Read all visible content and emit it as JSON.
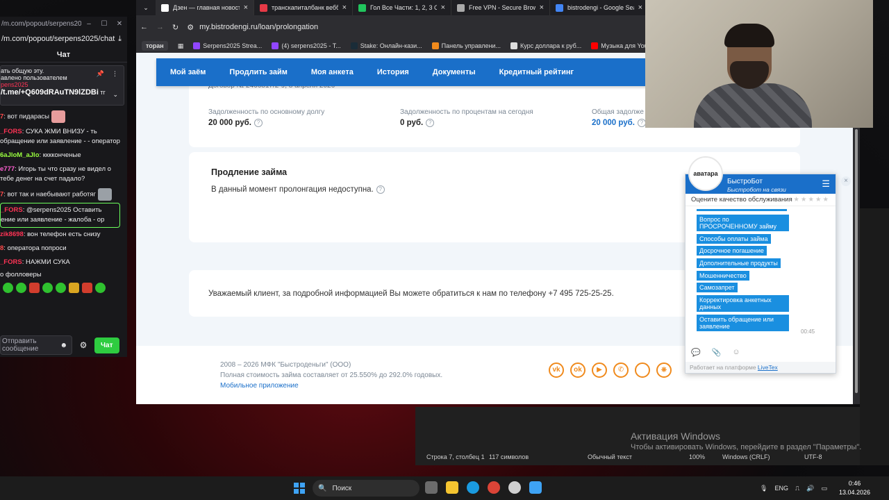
{
  "chat": {
    "window_url": "/m.com/popout/serpens20...",
    "address": "/m.com/popout/serpens2025/chat",
    "header": "Чат",
    "pinned_line1": "ать общую эту.",
    "pinned_line2": "авлено пользователем",
    "pinned_user": "pens2025",
    "pinned_link": "/t.me/+Q609dRAuTN9lZDBi",
    "pinned_suffix": "тг",
    "messages": [
      {
        "user": "7",
        "color": "#ff4a4a",
        "text": ": вот пидарасы"
      },
      {
        "user": "_FORS",
        "color": "#ff3355",
        "text": ": СУКА ЖМИ ВНИЗУ - ть обращение или заявление - - оператор"
      },
      {
        "user": "6aJloM_aJlo",
        "color": "#9aff3f",
        "text": ": кккконченые"
      },
      {
        "user": "e777",
        "color": "#ff5fd2",
        "text": ": Игорь ты что сразу не видел о тебе денег на счет падало?"
      },
      {
        "user": "7",
        "color": "#ff4a4a",
        "text": ": вот так и наебывают работяг"
      },
      {
        "user": "_FORS",
        "color": "#ff3355",
        "text": ": @serpens2025 Оставить ение или заявление - жалоба - ор"
      },
      {
        "user": "zik8698",
        "color": "#ff3355",
        "text": ": вон телефон есть снизу"
      },
      {
        "user": "8",
        "color": "#ff4a4a",
        "text": ": оператора попроси"
      },
      {
        "user": "_FORS",
        "color": "#ff3355",
        "text": ": НАЖМИ СУКА"
      }
    ],
    "followers": "о фолловеры",
    "input_placeholder": "Отправить сообщение",
    "send_label": "Чат"
  },
  "browser": {
    "tabs": [
      {
        "title": "Дзен — главная новост",
        "color": "#ffffff"
      },
      {
        "title": "транскапиталбанк вебб",
        "color": "#e63946"
      },
      {
        "title": "Гол Все Части: 1, 2, 3 Сп",
        "color": "#21c55d"
      },
      {
        "title": "Free VPN - Secure Brows",
        "color": "#aaaaaa"
      },
      {
        "title": "bistrodengi - Google Sea",
        "color": "#4285f4"
      }
    ],
    "url": "my.bistrodengi.ru/loan/prolongation",
    "bookmarks": [
      {
        "label": "торан",
        "color": "#3b3b40"
      },
      {
        "label": "Serpens2025 Strea...",
        "color": "#9146ff"
      },
      {
        "label": "(4) serpens2025 - T...",
        "color": "#9146ff"
      },
      {
        "label": "Stake: Онлайн-кази...",
        "color": "#1a2c38"
      },
      {
        "label": "Панель управлени...",
        "color": "#f08a1c"
      },
      {
        "label": "Курс доллара к руб...",
        "color": "#dddddd"
      },
      {
        "label": "Музыка для YouTu...",
        "color": "#ff0000"
      }
    ]
  },
  "site": {
    "nav": [
      "Мой заём",
      "Продлить займ",
      "Моя анкета",
      "История",
      "Документы",
      "Кредитный рейтинг"
    ],
    "contract": "Договор № 2466817/2-9, 8 апреля 2026",
    "debt_main_label": "Задолженность по основному долгу",
    "debt_main_value": "20 000 руб.",
    "debt_interest_label": "Задолженность по процентам на сегодня",
    "debt_interest_value": "0 руб.",
    "debt_total_label": "Общая задолже",
    "debt_total_value": "20 000 руб.",
    "prolong_title": "Продление займа",
    "prolong_text": "В данный момент пролонгация недоступна.",
    "contact_text": "Уважаемый клиент, за подробной информацией Вы можете обратиться к нам по телефону +7 495 725-25-25.",
    "footer_line1": "2008 – 2026 МФК \"Быстроденьги\" (ООО)",
    "footer_line2": "Полная стоимость займа составляет от 25.550% до 292.0% годовых.",
    "footer_link": "Мобильное приложение",
    "accent": "#1a6fc9",
    "orange": "#f08a1c"
  },
  "livetex": {
    "avatar_text": "аватара",
    "bot_name": "БыстроБот",
    "bot_sub": "Быстробот на связи",
    "rate_label": "Оцените качество обслуживания",
    "options": [
      "Вопрос по ПРОСРОЧЕННОМУ займу",
      "Способы оплаты займа",
      "Досрочное погашение",
      "Дополнительные продукты",
      "Мошенничество",
      "Самозапрет",
      "Корректировка анкетных данных",
      "Оставить обращение или заявление"
    ],
    "time": "00:45",
    "brand_text": "Работает на платформе",
    "brand_link": "LiveTex"
  },
  "notepad": {
    "position": "Строка 7, столбец 1",
    "chars": "117 символов",
    "mode": "Обычный текст",
    "zoom": "100%",
    "eol": "Windows (CRLF)",
    "encoding": "UTF-8"
  },
  "activation": {
    "title": "Активация Windows",
    "text": "Чтобы активировать Windows, перейдите в раздел \"Параметры\"."
  },
  "taskbar": {
    "search": "Поиск",
    "lang": "ENG",
    "time": "0:46",
    "date": "13.04.2026"
  }
}
